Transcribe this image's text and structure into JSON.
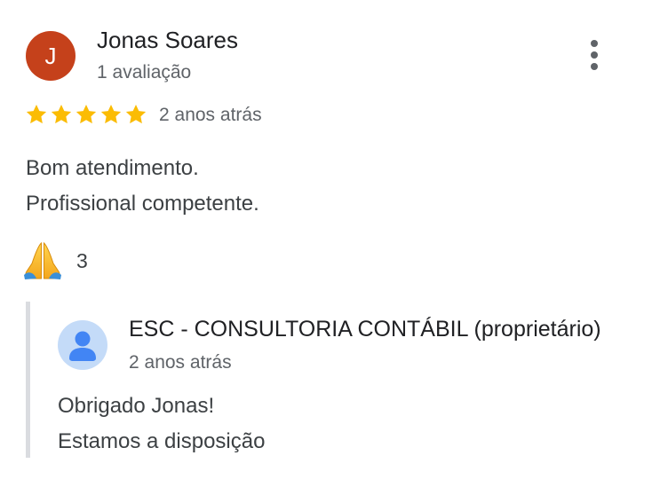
{
  "review": {
    "author": {
      "initial": "J",
      "name": "Jonas Soares",
      "review_count": "1 avaliação",
      "avatar_color": "#c5411b"
    },
    "rating": 5,
    "rating_max": 5,
    "star_color": "#fbbc04",
    "date": "2 anos atrás",
    "text_lines": [
      "Bom atendimento.",
      "Profissional competente."
    ],
    "reaction": {
      "emoji": "🙏",
      "count": "3"
    },
    "more_icon": "more-vert-icon"
  },
  "owner_reply": {
    "name": "ESC - CONSULTORIA CONTÁBIL (proprietário)",
    "date": "2 anos atrás",
    "text_lines": [
      "Obrigado Jonas!",
      "Estamos a disposição"
    ],
    "avatar_icon": "person-icon",
    "avatar_color": "#c4dbf8",
    "icon_color": "#4285f4"
  }
}
